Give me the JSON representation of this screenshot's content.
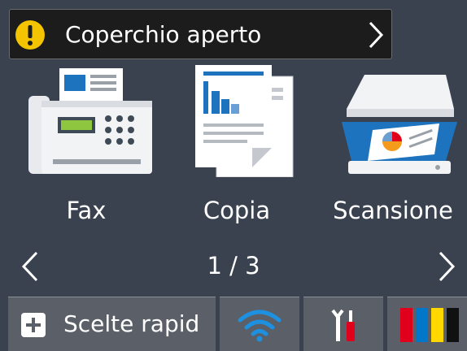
{
  "alert": {
    "text": "Coperchio aperto",
    "icon": "exclamation-icon",
    "color": "#f4c400"
  },
  "tiles": [
    {
      "label": "Fax",
      "icon": "fax-icon"
    },
    {
      "label": "Copia",
      "icon": "copy-icon"
    },
    {
      "label": "Scansione",
      "icon": "scanner-icon"
    }
  ],
  "pager": {
    "text": "1 / 3"
  },
  "bottom": {
    "quick_label": "Scelte rapid",
    "quick_icon": "plus-icon",
    "wifi_icon": "wifi-icon",
    "tools_icon": "tools-icon",
    "ink_icon": "ink-levels-icon"
  },
  "colors": {
    "background": "#3a4250",
    "accent_blue": "#1e73be",
    "warning_yellow": "#f4c400",
    "ink_red": "#e0001b",
    "ink_blue": "#0077c8",
    "ink_yellow": "#ffd800",
    "ink_black": "#111111"
  }
}
